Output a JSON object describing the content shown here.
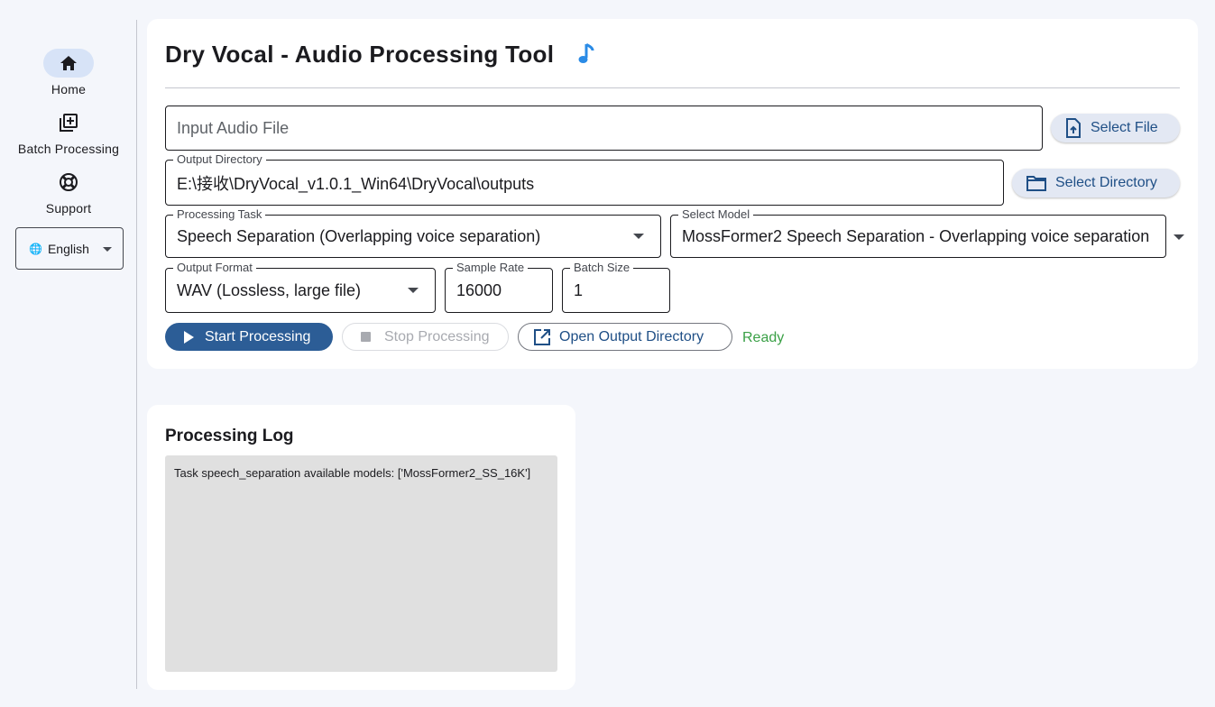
{
  "sidebar": {
    "items": [
      {
        "label": "Home",
        "icon": "home-icon",
        "active": true
      },
      {
        "label": "Batch Processing",
        "icon": "library-add-icon",
        "active": false
      },
      {
        "label": "Support",
        "icon": "lifebuoy-icon",
        "active": false
      }
    ],
    "language": {
      "globe": "🌐",
      "value": "English"
    }
  },
  "main": {
    "title": "Dry Vocal - Audio Processing Tool",
    "title_icon": "music-note-icon",
    "input_audio": {
      "placeholder": "Input Audio File",
      "value": ""
    },
    "select_file_label": "Select File",
    "output_dir": {
      "label": "Output Directory",
      "value": "E:\\接收\\DryVocal_v1.0.1_Win64\\DryVocal\\outputs"
    },
    "select_dir_label": "Select Directory",
    "processing_task": {
      "label": "Processing Task",
      "value": "Speech Separation (Overlapping voice separation)"
    },
    "select_model": {
      "label": "Select Model",
      "value": "MossFormer2 Speech Separation - Overlapping voice separation"
    },
    "output_format": {
      "label": "Output Format",
      "value": "WAV (Lossless, large file)"
    },
    "sample_rate": {
      "label": "Sample Rate",
      "value": "16000"
    },
    "batch_size": {
      "label": "Batch Size",
      "value": "1"
    },
    "start_label": "Start Processing",
    "stop_label": "Stop Processing",
    "open_output_label": "Open Output Directory",
    "status": "Ready"
  },
  "log": {
    "title": "Processing Log",
    "content": "Task speech_separation available models: ['MossFormer2_SS_16K']"
  },
  "colors": {
    "accent": "#2c5d96",
    "tonal": "#e3e8f3",
    "status_ok": "#3aa046",
    "note": "#2a8be6"
  }
}
